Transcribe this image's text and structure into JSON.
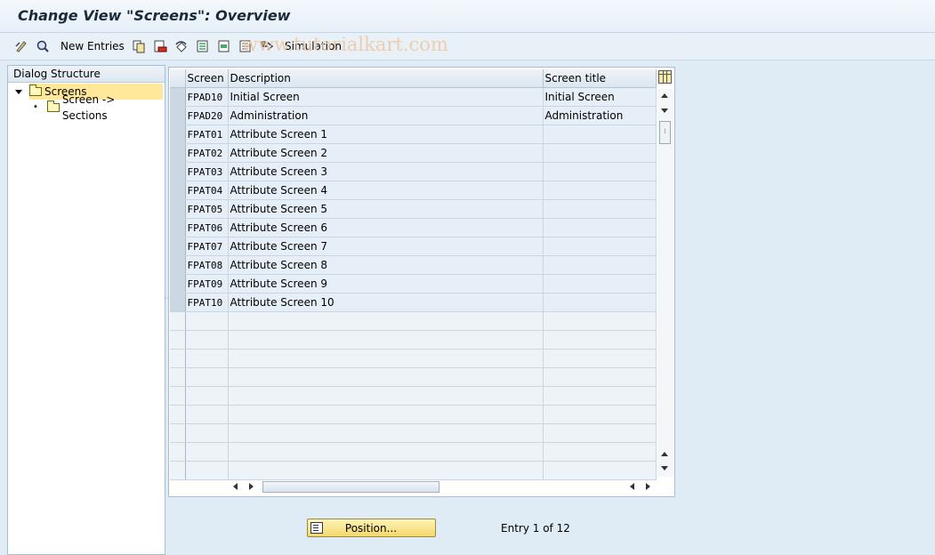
{
  "window": {
    "title": "Change View \"Screens\": Overview"
  },
  "toolbar": {
    "new_entries_label": "New Entries",
    "simulation_label": "Simulation",
    "watermark": "www.tutorialkart.com"
  },
  "dialog_structure": {
    "header": "Dialog Structure",
    "items": [
      {
        "label": "Screens",
        "selected": true,
        "expanded": true
      },
      {
        "label": "Screen -> Sections",
        "selected": false
      }
    ]
  },
  "table": {
    "columns": [
      "Screen",
      "Description",
      "Screen title"
    ],
    "rows": [
      {
        "screen": "FPAD10",
        "description": "Initial Screen",
        "title": "Initial Screen"
      },
      {
        "screen": "FPAD20",
        "description": "Administration",
        "title": "Administration"
      },
      {
        "screen": "FPAT01",
        "description": "Attribute Screen 1",
        "title": ""
      },
      {
        "screen": "FPAT02",
        "description": "Attribute Screen 2",
        "title": ""
      },
      {
        "screen": "FPAT03",
        "description": "Attribute Screen 3",
        "title": ""
      },
      {
        "screen": "FPAT04",
        "description": "Attribute Screen 4",
        "title": ""
      },
      {
        "screen": "FPAT05",
        "description": "Attribute Screen 5",
        "title": ""
      },
      {
        "screen": "FPAT06",
        "description": "Attribute Screen 6",
        "title": ""
      },
      {
        "screen": "FPAT07",
        "description": "Attribute Screen 7",
        "title": ""
      },
      {
        "screen": "FPAT08",
        "description": "Attribute Screen 8",
        "title": ""
      },
      {
        "screen": "FPAT09",
        "description": "Attribute Screen 9",
        "title": ""
      },
      {
        "screen": "FPAT10",
        "description": "Attribute Screen 10",
        "title": ""
      }
    ],
    "empty_rows": 9
  },
  "footer": {
    "position_label": "Position...",
    "entry_text": "Entry 1 of 12"
  }
}
